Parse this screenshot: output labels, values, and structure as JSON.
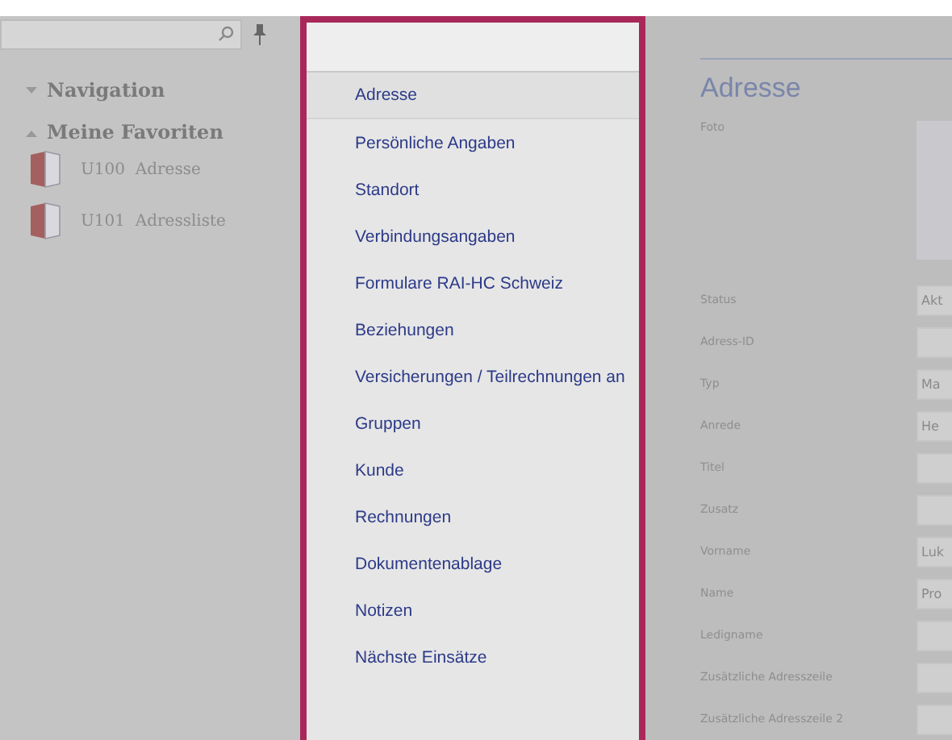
{
  "sidebar": {
    "sections": [
      {
        "title": "Navigation",
        "expanded": false
      },
      {
        "title": "Meine Favoriten",
        "expanded": true,
        "items": [
          {
            "code": "U100",
            "label": "Adresse"
          },
          {
            "code": "U101",
            "label": "Adressliste"
          }
        ]
      }
    ]
  },
  "menu": {
    "items": [
      {
        "label": "Adresse",
        "selected": true
      },
      {
        "label": "Persönliche Angaben",
        "selected": false
      },
      {
        "label": "Standort",
        "selected": false
      },
      {
        "label": "Verbindungsangaben",
        "selected": false
      },
      {
        "label": "Formulare RAI-HC Schweiz",
        "selected": false
      },
      {
        "label": "Beziehungen",
        "selected": false
      },
      {
        "label": "Versicherungen / Teilrechnungen an",
        "selected": false
      },
      {
        "label": "Gruppen",
        "selected": false
      },
      {
        "label": "Kunde",
        "selected": false
      },
      {
        "label": "Rechnungen",
        "selected": false
      },
      {
        "label": "Dokumentenablage",
        "selected": false
      },
      {
        "label": "Notizen",
        "selected": false
      },
      {
        "label": "Nächste Einsätze",
        "selected": false
      }
    ]
  },
  "form": {
    "title": "Adresse",
    "fields": [
      {
        "label": "Foto",
        "kind": "photo"
      },
      {
        "label": "Status",
        "kind": "input",
        "value": "Akt"
      },
      {
        "label": "Adress-ID",
        "kind": "input"
      },
      {
        "label": "Typ",
        "kind": "input",
        "value": "Ma"
      },
      {
        "label": "Anrede",
        "kind": "input",
        "value": "He"
      },
      {
        "label": "Titel",
        "kind": "input"
      },
      {
        "label": "Zusatz",
        "kind": "input"
      },
      {
        "label": "Vorname",
        "kind": "input",
        "value": "Luk"
      },
      {
        "label": "Name",
        "kind": "input",
        "value": "Pro"
      },
      {
        "label": "Ledigname",
        "kind": "input"
      },
      {
        "label": "Zusätzliche Adresszeile",
        "kind": "input"
      },
      {
        "label": "Zusätzliche Adresszeile 2",
        "kind": "input"
      }
    ]
  }
}
